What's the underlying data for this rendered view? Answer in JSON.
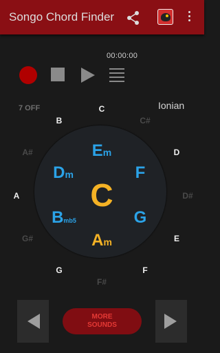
{
  "app": {
    "title": "Songo Chord Finder"
  },
  "toolbar": {
    "share_icon": "share-icon",
    "app_icon": "app-icon",
    "menu_icon": "kebab-menu-icon"
  },
  "player": {
    "time": "00:00:00",
    "record_icon": "record-icon",
    "stop_icon": "stop-icon",
    "play_icon": "play-icon",
    "list_icon": "list-icon"
  },
  "labels": {
    "off": "7 OFF",
    "mode": "Ionian"
  },
  "outer_notes": [
    "C",
    "C#",
    "D",
    "D#",
    "E",
    "F",
    "F#",
    "G",
    "G#",
    "A",
    "A#",
    "B"
  ],
  "chords": {
    "em": {
      "root": "E",
      "suffix": "m"
    },
    "f": {
      "root": "F"
    },
    "g": {
      "root": "G"
    },
    "am": {
      "root": "A",
      "suffix": "m"
    },
    "bmb5": {
      "root": "B",
      "suffix": "mb5"
    },
    "dm": {
      "root": "D",
      "suffix": "m"
    },
    "center": "C"
  },
  "colors": {
    "accent": "#8a0f14",
    "chord_blue": "#2ba3e8",
    "chord_gold": "#f4b225",
    "record": "#b00000"
  },
  "bottom": {
    "more_line1": "MORE",
    "more_line2": "SOUNDS"
  }
}
